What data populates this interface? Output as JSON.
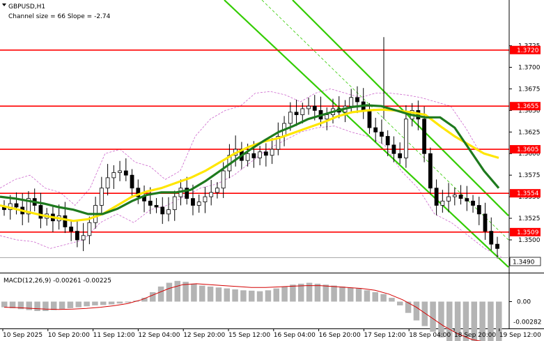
{
  "header": {
    "symbol": "GBPUSD,H1",
    "channel_info": "Channel size = 66 Slope = -2.74"
  },
  "macd": {
    "label": "MACD(12,26,9) -0.00261 -0.00225",
    "ticks": [
      "0.00",
      "-0.00282"
    ]
  },
  "colors": {
    "background": "#ffffff",
    "candle": "#000000",
    "level_line": "#ff0000",
    "level_box": "#ff0000",
    "ma_fast": "#ffe600",
    "ma_slow": "#1e7a1e",
    "channel": "#33cc00",
    "bollinger": "#cc66cc",
    "macd_hist": "#b4b4b4",
    "macd_signal": "#d40000"
  },
  "icons": {
    "header_marker": "triangle-down-icon"
  },
  "chart_data": {
    "type": "candlestick",
    "symbol": "GBPUSD",
    "timeframe": "H1",
    "ylim": [
      1.3462,
      1.3778
    ],
    "y_ticks": [
      "1.3475",
      "1.3500",
      "1.3525",
      "1.3550",
      "1.3575",
      "1.3600",
      "1.3625",
      "1.3650",
      "1.3675",
      "1.3700",
      "1.3725"
    ],
    "x_tick_labels": [
      "10 Sep 2025",
      "10 Sep 20:00",
      "11 Sep 12:00",
      "12 Sep 04:00",
      "12 Sep 20:00",
      "15 Sep 12:00",
      "16 Sep 04:00",
      "16 Sep 20:00",
      "17 Sep 12:00",
      "18 Sep 04:00",
      "18 Sep 20:00",
      "19 Sep 12:00"
    ],
    "levels": [
      {
        "label": "1.3720",
        "value": 1.372
      },
      {
        "label": "1.3655",
        "value": 1.3655
      },
      {
        "label": "1.3605",
        "value": 1.3605
      },
      {
        "label": "1.3554",
        "value": 1.3554
      },
      {
        "label": "1.3509",
        "value": 1.3509
      }
    ],
    "current_price": {
      "label": "1.3490",
      "value": 1.349
    },
    "close_series": [
      1.3535,
      1.3542,
      1.3538,
      1.353,
      1.3548,
      1.354,
      1.3525,
      1.353,
      1.3522,
      1.3528,
      1.3515,
      1.351,
      1.35,
      1.3505,
      1.352,
      1.354,
      1.356,
      1.3572,
      1.3578,
      1.358,
      1.3575,
      1.356,
      1.355,
      1.3545,
      1.354,
      1.3538,
      1.353,
      1.3535,
      1.355,
      1.356,
      1.3548,
      1.354,
      1.3544,
      1.355,
      1.3555,
      1.356,
      1.358,
      1.3598,
      1.3605,
      1.3592,
      1.36,
      1.3595,
      1.3602,
      1.3598,
      1.3605,
      1.362,
      1.3635,
      1.3648,
      1.3645,
      1.3652,
      1.3655,
      1.365,
      1.364,
      1.3645,
      1.3652,
      1.3648,
      1.3655,
      1.3665,
      1.366,
      1.365,
      1.363,
      1.3625,
      1.362,
      1.361,
      1.36,
      1.3595,
      1.364,
      1.365,
      1.364,
      1.36,
      1.356,
      1.354,
      1.3545,
      1.355,
      1.3552,
      1.3548,
      1.3545,
      1.354,
      1.353,
      1.351,
      1.3495,
      1.349
    ],
    "ma_fast": [
      1.354,
      1.3536,
      1.3532,
      1.3528,
      1.3525,
      1.3522,
      1.3524,
      1.353,
      1.354,
      1.355,
      1.3556,
      1.356,
      1.3566,
      1.3572,
      1.358,
      1.359,
      1.36,
      1.3608,
      1.3614,
      1.3618,
      1.3624,
      1.363,
      1.3636,
      1.3643,
      1.3648,
      1.365,
      1.3651,
      1.365,
      1.3648,
      1.3645,
      1.3632,
      1.362,
      1.361,
      1.36,
      1.3595
    ],
    "ma_slow": [
      1.355,
      1.3548,
      1.3545,
      1.3542,
      1.3538,
      1.3535,
      1.353,
      1.353,
      1.3536,
      1.3545,
      1.3552,
      1.3555,
      1.3555,
      1.3558,
      1.3568,
      1.358,
      1.3592,
      1.3604,
      1.3615,
      1.3625,
      1.3632,
      1.364,
      1.3645,
      1.365,
      1.3654,
      1.3656,
      1.3655,
      1.365,
      1.3645,
      1.3642,
      1.3642,
      1.363,
      1.3605,
      1.358,
      1.356
    ],
    "bb_upper": [
      1.356,
      1.357,
      1.3575,
      1.356,
      1.3555,
      1.354,
      1.356,
      1.36,
      1.3605,
      1.359,
      1.3585,
      1.357,
      1.358,
      1.362,
      1.364,
      1.365,
      1.3655,
      1.367,
      1.3672,
      1.3668,
      1.366,
      1.367,
      1.3675,
      1.367,
      1.3665,
      1.367,
      1.367,
      1.3668,
      1.3665,
      1.366,
      1.3655,
      1.363,
      1.36
    ],
    "bb_lower": [
      1.3505,
      1.35,
      1.3498,
      1.349,
      1.3495,
      1.35,
      1.352,
      1.353,
      1.352,
      1.3535,
      1.354,
      1.355,
      1.356,
      1.3565,
      1.3575,
      1.359,
      1.3605,
      1.3615,
      1.3625,
      1.363,
      1.3632,
      1.3625,
      1.362,
      1.361,
      1.358,
      1.356,
      1.353,
      1.352,
      1.3505,
      1.349,
      1.348
    ],
    "channel_lines": [
      {
        "x0_index": 0,
        "x1_index": 1,
        "y0": 1.3778,
        "y1": 1.3505
      },
      {
        "x0_index": 0,
        "x1_index": 1,
        "y0": 1.3778,
        "y1": 1.3528
      },
      {
        "x0_index": 0,
        "x1_index": 1,
        "y0": 1.3778,
        "y1": 1.347
      }
    ],
    "macd_hist": [
      -0.0003,
      -0.00035,
      -0.0004,
      -0.00045,
      -0.0005,
      -0.0005,
      -0.00045,
      -0.0004,
      -0.00035,
      -0.0003,
      -0.00025,
      -0.0002,
      -0.00018,
      -0.00015,
      -0.0001,
      -5e-05,
      5e-05,
      0.0002,
      0.0005,
      0.0008,
      0.001,
      0.0011,
      0.00105,
      0.00095,
      0.00085,
      0.0008,
      0.00075,
      0.0007,
      0.00065,
      0.0006,
      0.00058,
      0.00055,
      0.0006,
      0.0007,
      0.0008,
      0.0009,
      0.00095,
      0.001,
      0.00095,
      0.0009,
      0.00085,
      0.0008,
      0.00075,
      0.0007,
      0.0006,
      0.0005,
      0.0004,
      0.0002,
      -0.0002,
      -0.0006,
      -0.001,
      -0.0013,
      -0.0016,
      -0.0019,
      -0.0022,
      -0.0024,
      -0.0025,
      -0.00255,
      -0.00258,
      -0.0026,
      -0.00261
    ],
    "macd_signal": [
      -0.0003,
      -0.00032,
      -0.00036,
      -0.0004,
      -0.00042,
      -0.0004,
      -0.00036,
      -0.0003,
      -0.00022,
      -0.0001,
      0.0001,
      0.0004,
      0.0007,
      0.0009,
      0.00095,
      0.0009,
      0.00085,
      0.0008,
      0.00075,
      0.00075,
      0.00078,
      0.00082,
      0.00085,
      0.00085,
      0.0008,
      0.00075,
      0.0007,
      0.0006,
      0.0004,
      0.0001,
      -0.0003,
      -0.0008,
      -0.0013,
      -0.0017,
      -0.002,
      -0.00215,
      -0.00225
    ]
  }
}
